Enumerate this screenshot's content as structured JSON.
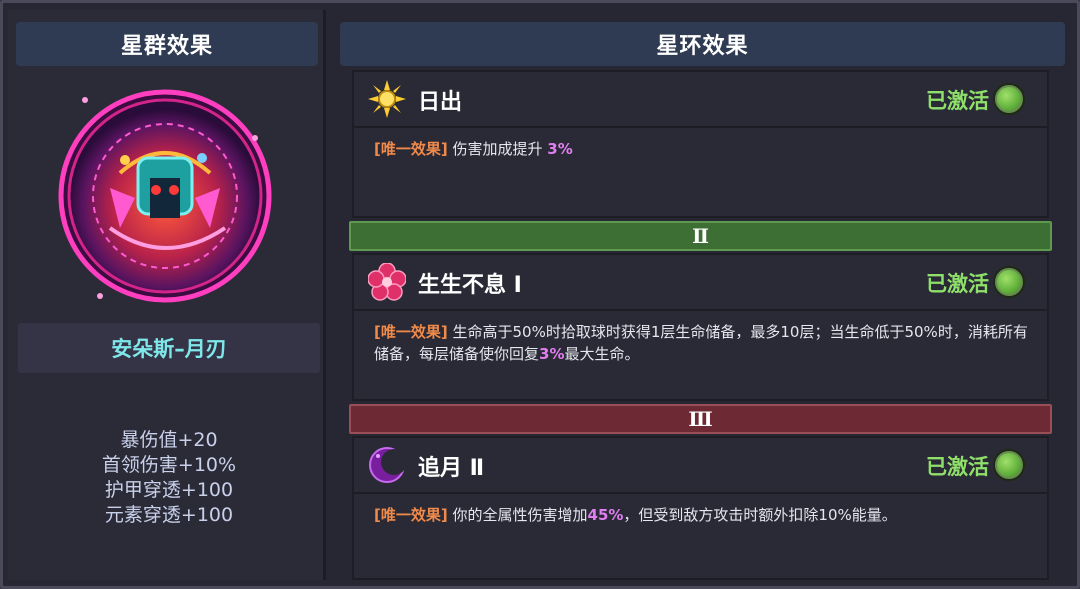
{
  "left_panel": {
    "title": "星群效果",
    "name": "安朵斯–月刃",
    "stats": [
      "暴伤值+20",
      "首领伤害+10%",
      "护甲穿透+100",
      "元素穿透+100"
    ]
  },
  "right_panel": {
    "title": "星环效果",
    "cards": [
      {
        "icon": "sun-icon",
        "title": "日出",
        "status": "已激活",
        "tag": "[唯一效果]",
        "text_parts": [
          "伤害加成提升 ",
          "3%",
          ""
        ]
      },
      {
        "icon": "flower-icon",
        "title": "生生不息 Ⅰ",
        "status": "已激活",
        "tag": "[唯一效果]",
        "text_parts": [
          "生命高于50%时拾取球时获得1层生命储备，最多10层；当生命低于50%时，消耗所有储备，每层储备使你回复",
          "3%",
          "最大生命。"
        ]
      },
      {
        "icon": "moon-icon",
        "title": "追月 Ⅱ",
        "status": "已激活",
        "tag": "[唯一效果]",
        "text_parts": [
          "你的全属性伤害增加",
          "45%",
          "，但受到敌方攻击时额外扣除10%能量。"
        ]
      }
    ],
    "dividers": [
      "Ⅱ",
      "Ⅲ"
    ]
  },
  "colors": {
    "active": "#8fe06a",
    "tag": "#ef8a4a",
    "highlight": "#e07ef0",
    "name": "#7fe6ea",
    "divider_green": "#3d6e33",
    "divider_red": "#6e2a34"
  }
}
